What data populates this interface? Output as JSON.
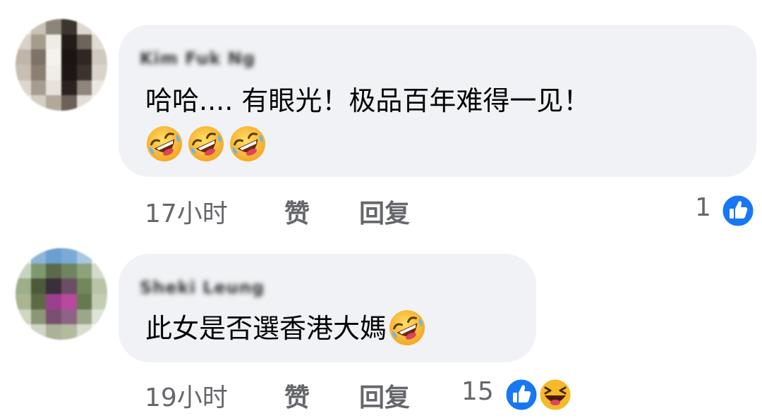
{
  "comments": [
    {
      "author": "Kim Fuk Ng",
      "text": "哈哈.... 有眼光！极品百年难得一见！",
      "emojis": [
        "rolling-on-floor-laughing",
        "rolling-on-floor-laughing",
        "rolling-on-floor-laughing"
      ],
      "time": "17小时",
      "like_label": "赞",
      "reply_label": "回复",
      "reaction_count": "1",
      "reaction_icons": [
        "like-icon"
      ]
    },
    {
      "author": "Sheki Leung",
      "text": "此女是否選香港大媽",
      "emojis": [
        "rolling-on-floor-laughing"
      ],
      "time": "19小时",
      "like_label": "赞",
      "reply_label": "回复",
      "reaction_count": "15",
      "reaction_icons": [
        "like-icon",
        "haha-icon"
      ]
    }
  ],
  "colors": {
    "bubble": "#f0f2f5",
    "meta_text": "#65676b",
    "like_blue": "#1877f2",
    "haha_yellow": "#f7b928"
  }
}
